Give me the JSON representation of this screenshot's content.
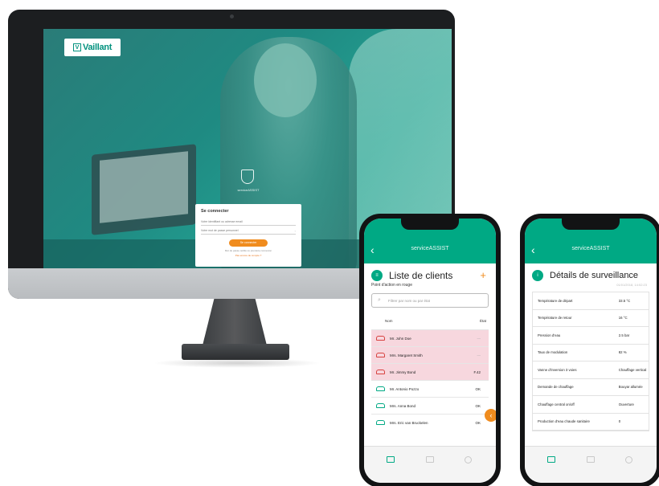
{
  "desktop": {
    "brand": {
      "mark": "V",
      "name": "Vaillant"
    },
    "login": {
      "shield_label": "serviceASSIST",
      "title": "Se connecter",
      "email_placeholder": "Votre identifiant ou adresse email",
      "password_placeholder": "Votre mot de passe personnel",
      "submit_label": "Se connecter",
      "forgot_label": "Mot de passe oublié ou première connexion",
      "signup_label": "Pas encore de compte ?"
    }
  },
  "phone_left": {
    "app_title": "serviceASSIST",
    "back_icon": "‹",
    "header_icon": "≡",
    "page_title": "Liste de clients",
    "add_icon": "+",
    "subtitle": "Point d'action en rouge",
    "search_icon": "⌕",
    "search_placeholder": "Filtrer par nom ou par état",
    "columns": {
      "name": "Nom",
      "state": "État"
    },
    "rows": [
      {
        "name": "Mr. John Doe",
        "state": "—",
        "alert": true
      },
      {
        "name": "Mrs. Margaret Smith",
        "state": "—",
        "alert": true
      },
      {
        "name": "Mr. Jimmy Bond",
        "state": "F.42",
        "alert": true
      },
      {
        "name": "Mr. Antonio Pozzo",
        "state": "OK",
        "alert": false
      },
      {
        "name": "Mrs. Anna Bond",
        "state": "OK",
        "alert": false
      },
      {
        "name": "Mrs. Eric van Bruckelen",
        "state": "OK",
        "alert": false
      }
    ],
    "fab_icon": "‹"
  },
  "phone_right": {
    "app_title": "serviceASSIST",
    "back_icon": "‹",
    "header_icon": "i",
    "page_title": "Détails de surveillance",
    "date": "01/01/2018, 14:02:23",
    "rows": [
      {
        "label": "Température de départ",
        "value": "33.5 °C"
      },
      {
        "label": "Température de retour",
        "value": "16 °C"
      },
      {
        "label": "Pression d'eau",
        "value": "2.5 bar"
      },
      {
        "label": "Taux de modulation",
        "value": "82 %"
      },
      {
        "label": "Vanne d'inversion 3 voies",
        "value": "Chauffage vertical"
      },
      {
        "label": "Demande de chauffage",
        "value": "Bouyar allumée"
      },
      {
        "label": "Chauffage central on/off",
        "value": "Ouverture"
      },
      {
        "label": "Production d'eau chaude sanitaire",
        "value": "0"
      }
    ]
  }
}
